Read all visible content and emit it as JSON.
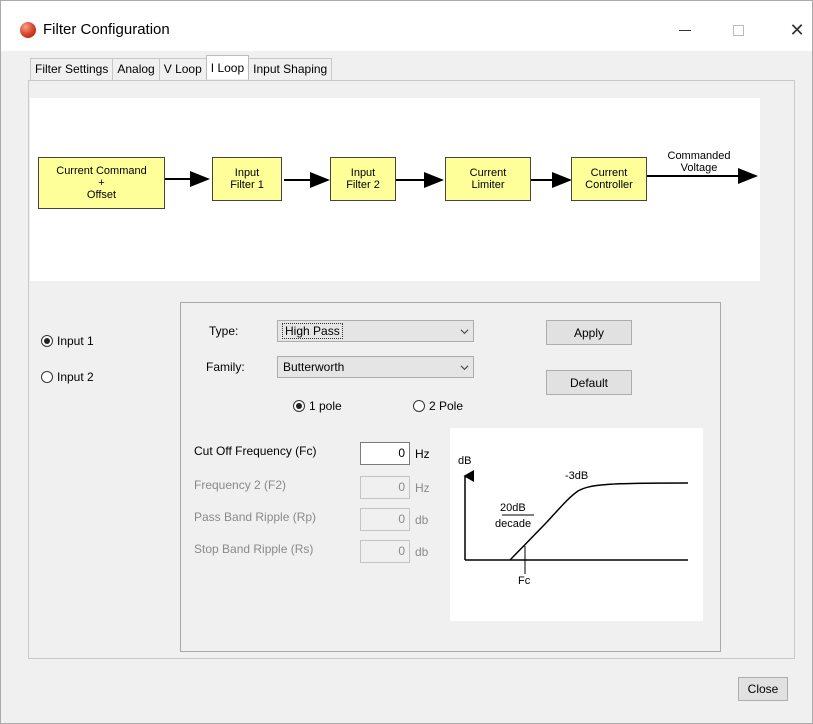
{
  "window": {
    "title": "Filter Configuration",
    "minimize_glyph": "—",
    "maximize_glyph": "☐",
    "close_glyph": "✕"
  },
  "tabs": [
    {
      "label": "Filter Settings",
      "active": false
    },
    {
      "label": "Analog",
      "active": false
    },
    {
      "label": "V Loop",
      "active": false
    },
    {
      "label": "I Loop",
      "active": true
    },
    {
      "label": "Input Shaping",
      "active": false
    }
  ],
  "diagram": {
    "blocks": [
      {
        "lines": [
          "Current Command",
          "+",
          "Offset"
        ]
      },
      {
        "lines": [
          "Input",
          "Filter 1"
        ]
      },
      {
        "lines": [
          "Input",
          "Filter 2"
        ]
      },
      {
        "lines": [
          "Current",
          "Limiter"
        ]
      },
      {
        "lines": [
          "Current",
          "Controller"
        ]
      }
    ],
    "output_label": [
      "Commanded",
      "Voltage"
    ],
    "block_color": "#ffff99"
  },
  "inputs": {
    "input1": {
      "label": "Input 1",
      "checked": true
    },
    "input2": {
      "label": "Input 2",
      "checked": false
    }
  },
  "filter": {
    "type_label": "Type:",
    "type_value": "High Pass",
    "family_label": "Family:",
    "family_value": "Butterworth",
    "pole1_label": "1 pole",
    "pole2_label": "2 Pole",
    "pole1_checked": true,
    "apply_label": "Apply",
    "default_label": "Default",
    "fields": [
      {
        "label": "Cut Off Frequency (Fc)",
        "value": "0",
        "unit": "Hz",
        "enabled": true
      },
      {
        "label": "Frequency 2  (F2)",
        "value": "0",
        "unit": "Hz",
        "enabled": false
      },
      {
        "label": "Pass Band Ripple (Rp)",
        "value": "0",
        "unit": "db",
        "enabled": false
      },
      {
        "label": "Stop Band Ripple (Rs)",
        "value": "0",
        "unit": "db",
        "enabled": false
      }
    ]
  },
  "response": {
    "y_label": "dB",
    "corner_label": "-3dB",
    "slope_numerator": "20dB",
    "slope_denominator": "decade",
    "x_marker": "Fc"
  },
  "close_label": "Close"
}
